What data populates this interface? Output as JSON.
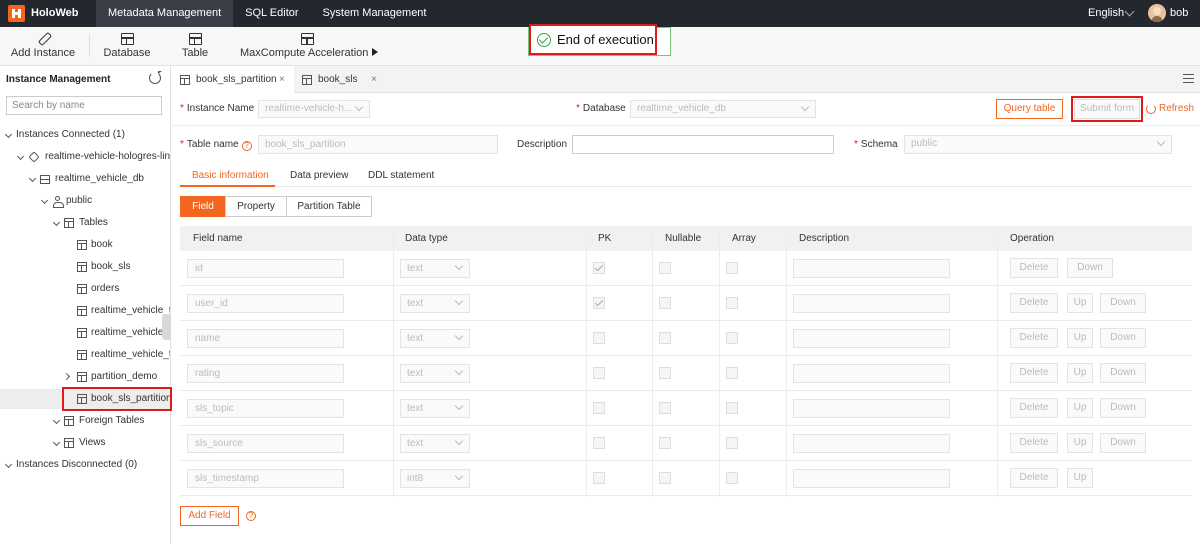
{
  "app": {
    "brand": "HoloWeb"
  },
  "topnav": [
    {
      "label": "Metadata Management",
      "active": true
    },
    {
      "label": "SQL Editor",
      "active": false
    },
    {
      "label": "System Management",
      "active": false
    }
  ],
  "header": {
    "language": "English",
    "user": "bob"
  },
  "toolbar": {
    "add_instance": "Add Instance",
    "database": "Database",
    "table": "Table",
    "maxcompute": "MaxCompute Acceleration"
  },
  "toast": {
    "text": "End of execution"
  },
  "sidebar": {
    "title": "Instance Management",
    "search_placeholder": "Search by name",
    "tree": [
      {
        "label": "Instances Connected (1)"
      },
      {
        "label": "realtime-vehicle-hologres-lin"
      },
      {
        "label": "realtime_vehicle_db"
      },
      {
        "label": "public"
      },
      {
        "label": "Tables"
      },
      {
        "label": "book"
      },
      {
        "label": "book_sls"
      },
      {
        "label": "orders"
      },
      {
        "label": "realtime_vehicle_t"
      },
      {
        "label": "realtime_vehicle_t"
      },
      {
        "label": "realtime_vehicle_t"
      },
      {
        "label": "partition_demo"
      },
      {
        "label": "book_sls_partition"
      },
      {
        "label": "Foreign Tables"
      },
      {
        "label": "Views"
      },
      {
        "label": "Instances Disconnected (0)"
      }
    ]
  },
  "tabs": [
    {
      "label": "book_sls_partition",
      "close": "×"
    },
    {
      "label": "book_sls",
      "close": "×"
    }
  ],
  "form": {
    "instance_label": "Instance Name",
    "instance_value": "realtime-vehicle-h...",
    "database_label": "Database",
    "database_value": "realtime_vehicle_db",
    "query_table": "Query table",
    "submit_form": "Submit form",
    "refresh": "Refresh",
    "table_name_label": "Table name",
    "table_name_value": "book_sls_partition",
    "description_label": "Description",
    "schema_label": "Schema",
    "schema_value": "public",
    "required_mark": "*",
    "help_mark": "?"
  },
  "subtabs": [
    "Basic information",
    "Data preview",
    "DDL statement"
  ],
  "segments": [
    "Field",
    "Property",
    "Partition Table"
  ],
  "table": {
    "headers": [
      "Field name",
      "Data type",
      "PK",
      "Nullable",
      "Array",
      "Description",
      "Operation"
    ],
    "rows": [
      {
        "name": "id",
        "type": "text",
        "pk": true,
        "ops": [
          "Delete",
          "Down"
        ]
      },
      {
        "name": "user_id",
        "type": "text",
        "pk": true,
        "ops": [
          "Delete",
          "Up",
          "Down"
        ]
      },
      {
        "name": "name",
        "type": "text",
        "pk": false,
        "ops": [
          "Delete",
          "Up",
          "Down"
        ]
      },
      {
        "name": "rating",
        "type": "text",
        "pk": false,
        "ops": [
          "Delete",
          "Up",
          "Down"
        ]
      },
      {
        "name": "sls_topic",
        "type": "text",
        "pk": false,
        "ops": [
          "Delete",
          "Up",
          "Down"
        ]
      },
      {
        "name": "sls_source",
        "type": "text",
        "pk": false,
        "ops": [
          "Delete",
          "Up",
          "Down"
        ]
      },
      {
        "name": "sls_timestamp",
        "type": "int8",
        "pk": false,
        "ops": [
          "Delete",
          "Up"
        ]
      }
    ]
  },
  "add_field": "Add Field",
  "colors": {
    "accent": "#f2661f",
    "topbar": "#23272e",
    "highlight": "#e01a1a",
    "success": "#3aa64a"
  }
}
